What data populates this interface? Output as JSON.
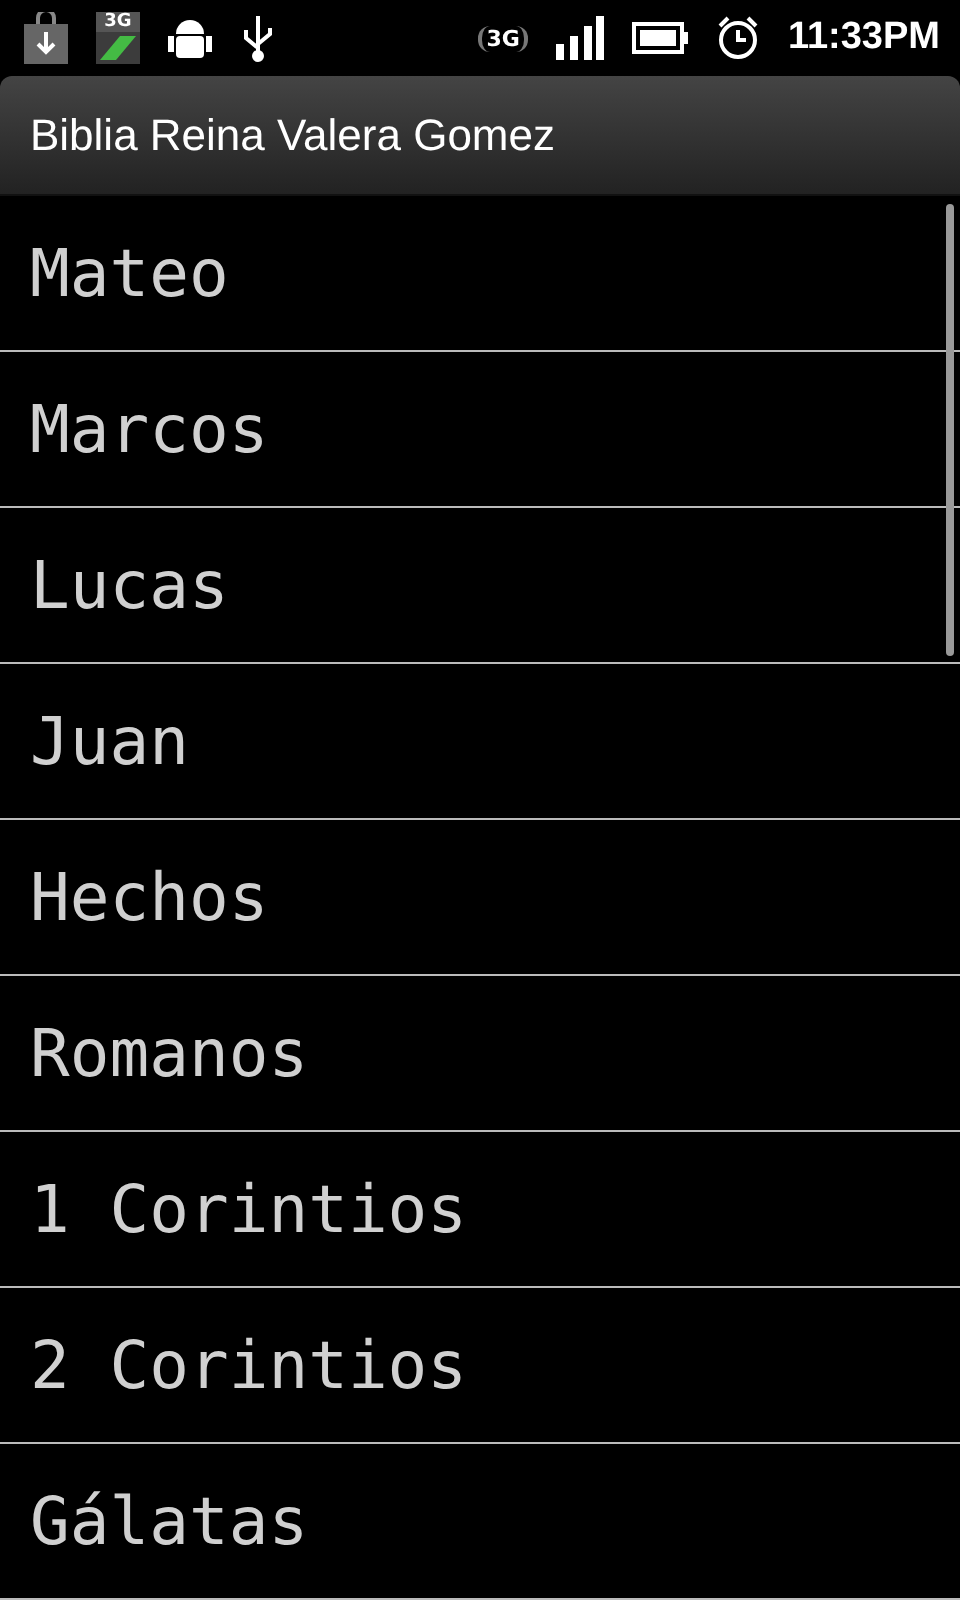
{
  "status_bar": {
    "sim_label": "3G",
    "data_label": "3G",
    "time": "11:33PM"
  },
  "title_bar": {
    "title": "Biblia Reina Valera Gomez"
  },
  "books": [
    "Mateo",
    "Marcos",
    "Lucas",
    "Juan",
    "Hechos",
    "Romanos",
    "1 Corintios",
    "2 Corintios",
    "Gálatas"
  ]
}
